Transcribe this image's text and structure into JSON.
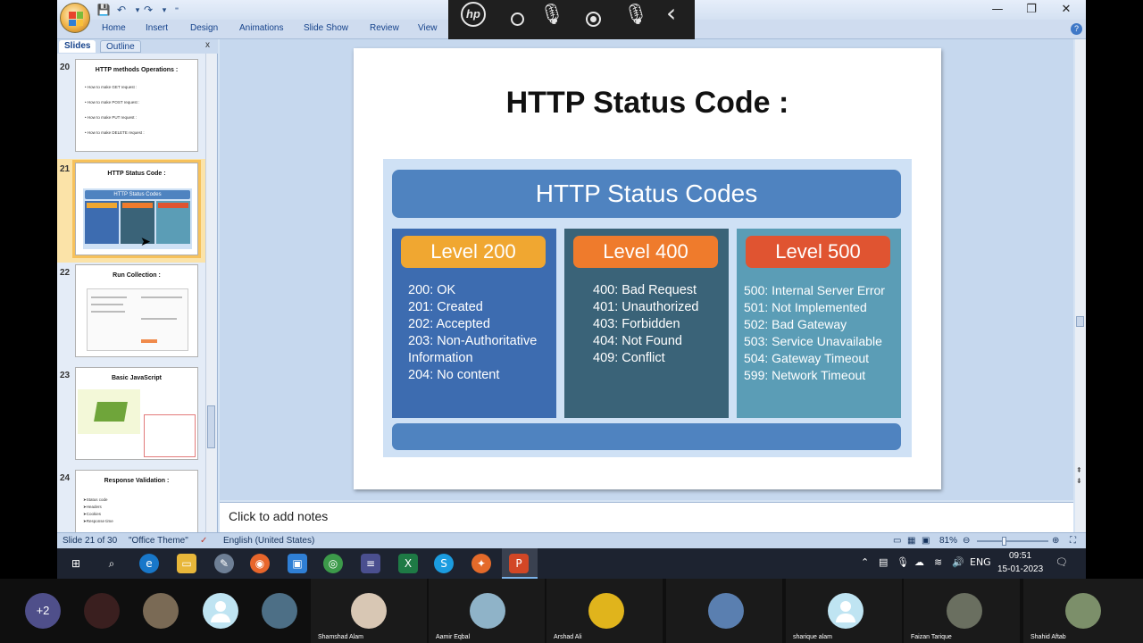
{
  "colors": {
    "ribbon_text": "#15428b",
    "header_blue": "#4f83c0",
    "col200": "#3d6cb0",
    "col400": "#3a6378",
    "col500": "#5b9db6",
    "badge200": "#f0a731",
    "badge400": "#ef7b2c",
    "badge500": "#e05431"
  },
  "window": {
    "ribbon_tabs": [
      "Home",
      "Insert",
      "Design",
      "Animations",
      "Slide Show",
      "Review",
      "View"
    ],
    "controls": {
      "minimize": "—",
      "restore": "❐",
      "close": "✕"
    },
    "qat": {
      "save_icon": "save-icon",
      "undo_icon": "undo-icon",
      "redo_icon": "redo-icon"
    }
  },
  "hp_toolbar": {
    "logo": "hp",
    "icons": [
      "circle-icon",
      "microphone-icon",
      "record-icon",
      "podcast-mic-icon",
      "chevron-left-icon"
    ],
    "chevron": "‹"
  },
  "slides_panel": {
    "tabs": [
      "Slides",
      "Outline"
    ],
    "close": "x",
    "thumbnails": [
      {
        "number": "20",
        "title": "HTTP methods Operations :",
        "bullets": [
          "How to make GET request :",
          "How to make POST request :",
          "How to make PUT request :",
          "How to make DELETE request :"
        ]
      },
      {
        "number": "21",
        "title": "HTTP Status Code :",
        "selected": true
      },
      {
        "number": "22",
        "title": "Run Collection :"
      },
      {
        "number": "23",
        "title": "Basic JavaScript"
      },
      {
        "number": "24",
        "title": "Response Validation :",
        "bullets": [
          "➤Status code",
          "➤Headers",
          "➤Cookies",
          "➤Response time"
        ]
      }
    ]
  },
  "slide": {
    "title": "HTTP Status Code :",
    "graphic_title": "HTTP Status Codes",
    "columns": [
      {
        "level": "Level 200",
        "codes": [
          "200: OK",
          "201: Created",
          "202: Accepted",
          "203: Non-Authoritative Information",
          "204: No content"
        ]
      },
      {
        "level": "Level 400",
        "codes": [
          "400: Bad Request",
          "401: Unauthorized",
          "403: Forbidden",
          "404: Not Found",
          "409: Conflict"
        ]
      },
      {
        "level": "Level 500",
        "codes": [
          "500: Internal Server Error",
          "501: Not Implemented",
          "502: Bad Gateway",
          "503: Service Unavailable",
          "504: Gateway Timeout",
          "599: Network Timeout"
        ]
      }
    ]
  },
  "notes": {
    "placeholder": "Click to add notes"
  },
  "status_bar": {
    "slide_info": "Slide 21 of 30",
    "theme": "\"Office Theme\"",
    "language": "English (United States)",
    "zoom": "81%"
  },
  "taskbar": {
    "icons": [
      "windows-start-icon",
      "search-icon",
      "edge-icon",
      "file-explorer-icon",
      "paint-icon",
      "firefox-icon",
      "app-icon",
      "chrome-icon",
      "winamp-icon",
      "excel-icon",
      "skype-icon",
      "app-icon-2",
      "powerpoint-icon"
    ],
    "tray": {
      "language": "ENG",
      "time": "09:51",
      "date": "15-01-2023"
    }
  },
  "meeting": {
    "extra_count": "+2",
    "participants": [
      "Shamshad Alam",
      "Aamir Eqbal",
      "Arshad Ali",
      "",
      "sharique alam",
      "Faizan Tarique",
      "Shahid Aftab"
    ]
  }
}
